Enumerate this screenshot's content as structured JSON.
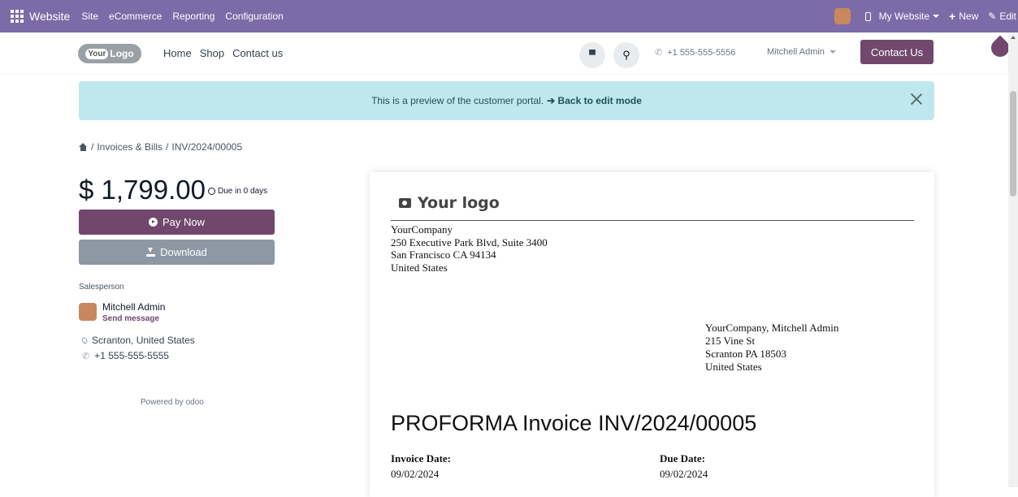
{
  "topbar": {
    "brand": "Website",
    "menu": [
      "Site",
      "eCommerce",
      "Reporting",
      "Configuration"
    ],
    "website_selector": "My Website",
    "new_label": "New",
    "edit_label": "Edit"
  },
  "header": {
    "logo_text": "YourLogo",
    "logo_prefix": "Your",
    "logo_suffix": "Logo",
    "nav": [
      "Home",
      "Shop",
      "Contact us"
    ],
    "phone": "+1 555-555-5556",
    "user": "Mitchell Admin",
    "contact_button": "Contact Us"
  },
  "alert": {
    "text": "This is a preview of the customer portal.",
    "link": "➔ Back to edit mode"
  },
  "breadcrumb": {
    "sep": "/",
    "items": [
      "Invoices & Bills",
      "INV/2024/00005"
    ]
  },
  "summary": {
    "amount": "$ 1,799.00",
    "due": "Due in 0 days",
    "pay_button": "Pay Now",
    "download_button": "Download"
  },
  "salesperson": {
    "label": "Salesperson",
    "name": "Mitchell Admin",
    "send_message": "Send message",
    "location": "Scranton, United States",
    "phone": "+1 555-555-5555"
  },
  "powered": {
    "text": "Powered by",
    "brand": "odoo"
  },
  "invoice": {
    "logo_label": "Your logo",
    "company_lines": [
      "YourCompany",
      "250 Executive Park Blvd, Suite 3400",
      "San Francisco CA 94134",
      "United States"
    ],
    "recipient_lines": [
      "YourCompany, Mitchell Admin",
      "215 Vine St",
      "Scranton PA 18503",
      "United States"
    ],
    "title": "PROFORMA Invoice INV/2024/00005",
    "invoice_date_label": "Invoice Date:",
    "invoice_date": "09/02/2024",
    "due_date_label": "Due Date:",
    "due_date": "09/02/2024"
  },
  "colors": {
    "topbar": "#7c6ba7",
    "primary": "#71476d",
    "secondary": "#8c98a4",
    "alert_bg": "#bfe8ee"
  }
}
